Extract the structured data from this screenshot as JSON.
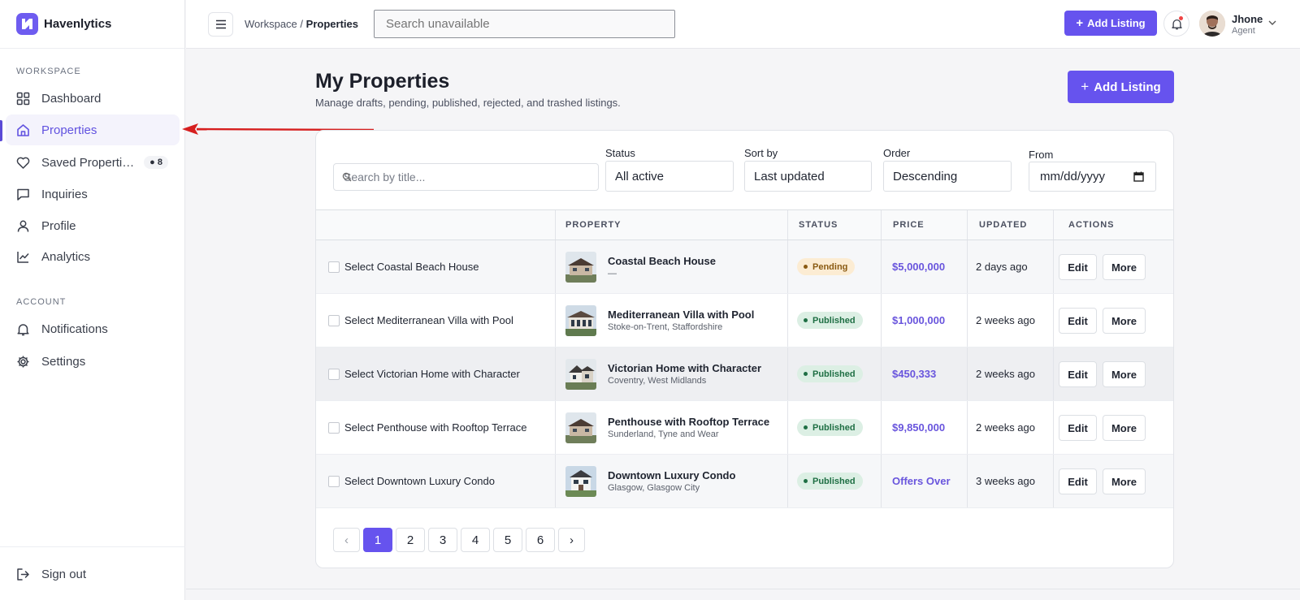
{
  "app": {
    "name": "Havenlytics"
  },
  "sidebar": {
    "workspace_label": "WORKSPACE",
    "account_label": "ACCOUNT",
    "items": [
      {
        "label": "Dashboard",
        "icon": "grid-icon"
      },
      {
        "label": "Properties",
        "icon": "home-icon",
        "active": true
      },
      {
        "label": "Saved Properti…",
        "icon": "heart-icon",
        "badge": "● 8"
      },
      {
        "label": "Inquiries",
        "icon": "chat-icon"
      },
      {
        "label": "Profile",
        "icon": "user-icon"
      },
      {
        "label": "Analytics",
        "icon": "chart-icon"
      }
    ],
    "account_items": [
      {
        "label": "Notifications",
        "icon": "bell-icon"
      },
      {
        "label": "Settings",
        "icon": "gear-icon"
      }
    ],
    "signout": "Sign out"
  },
  "topbar": {
    "breadcrumb_parent": "Workspace",
    "breadcrumb_sep": "/",
    "breadcrumb_current": "Properties",
    "search_placeholder": "Search unavailable",
    "add_listing": "Add Listing",
    "user_name": "Jhone",
    "user_role": "Agent"
  },
  "page": {
    "title": "My Properties",
    "subtitle": "Manage drafts, pending, published, rejected, and trashed listings.",
    "add_listing": "Add Listing"
  },
  "filters": {
    "search_placeholder": "Search by title...",
    "status_label": "Status",
    "status_value": "All active",
    "sort_label": "Sort by",
    "sort_value": "Last updated",
    "order_label": "Order",
    "order_value": "Descending",
    "from_label": "From",
    "from_value": "mm/dd/yyyy"
  },
  "table": {
    "headers": {
      "property": "PROPERTY",
      "status": "STATUS",
      "price": "PRICE",
      "updated": "UPDATED",
      "actions": "ACTIONS"
    },
    "rows": [
      {
        "select": "Select Coastal Beach House",
        "title": "Coastal Beach House",
        "location": "—",
        "status": "Pending",
        "price": "$5,000,000",
        "updated": "2 days ago",
        "edit": "Edit",
        "more": "More"
      },
      {
        "select": "Select Mediterranean Villa with Pool",
        "title": "Mediterranean Villa with Pool",
        "location": "Stoke-on-Trent, Staffordshire",
        "status": "Published",
        "price": "$1,000,000",
        "updated": "2 weeks ago",
        "edit": "Edit",
        "more": "More"
      },
      {
        "select": "Select Victorian Home with Character",
        "title": "Victorian Home with Character",
        "location": "Coventry, West Midlands",
        "status": "Published",
        "price": "$450,333",
        "updated": "2 weeks ago",
        "edit": "Edit",
        "more": "More"
      },
      {
        "select": "Select Penthouse with Rooftop Terrace",
        "title": "Penthouse with Rooftop Terrace",
        "location": "Sunderland, Tyne and Wear",
        "status": "Published",
        "price": "$9,850,000",
        "updated": "2 weeks ago",
        "edit": "Edit",
        "more": "More"
      },
      {
        "select": "Select Downtown Luxury Condo",
        "title": "Downtown Luxury Condo",
        "location": "Glasgow, Glasgow City",
        "status": "Published",
        "price": "Offers Over",
        "updated": "3 weeks ago",
        "edit": "Edit",
        "more": "More"
      }
    ]
  },
  "pagination": {
    "prev": "‹",
    "pages": [
      "1",
      "2",
      "3",
      "4",
      "5",
      "6"
    ],
    "next": "›",
    "current": "1"
  },
  "colors": {
    "accent": "#6653EE",
    "annotation_arrow": "#D61F1F",
    "pending_bg": "#FCECD3",
    "published_bg": "#DCEFE4"
  }
}
